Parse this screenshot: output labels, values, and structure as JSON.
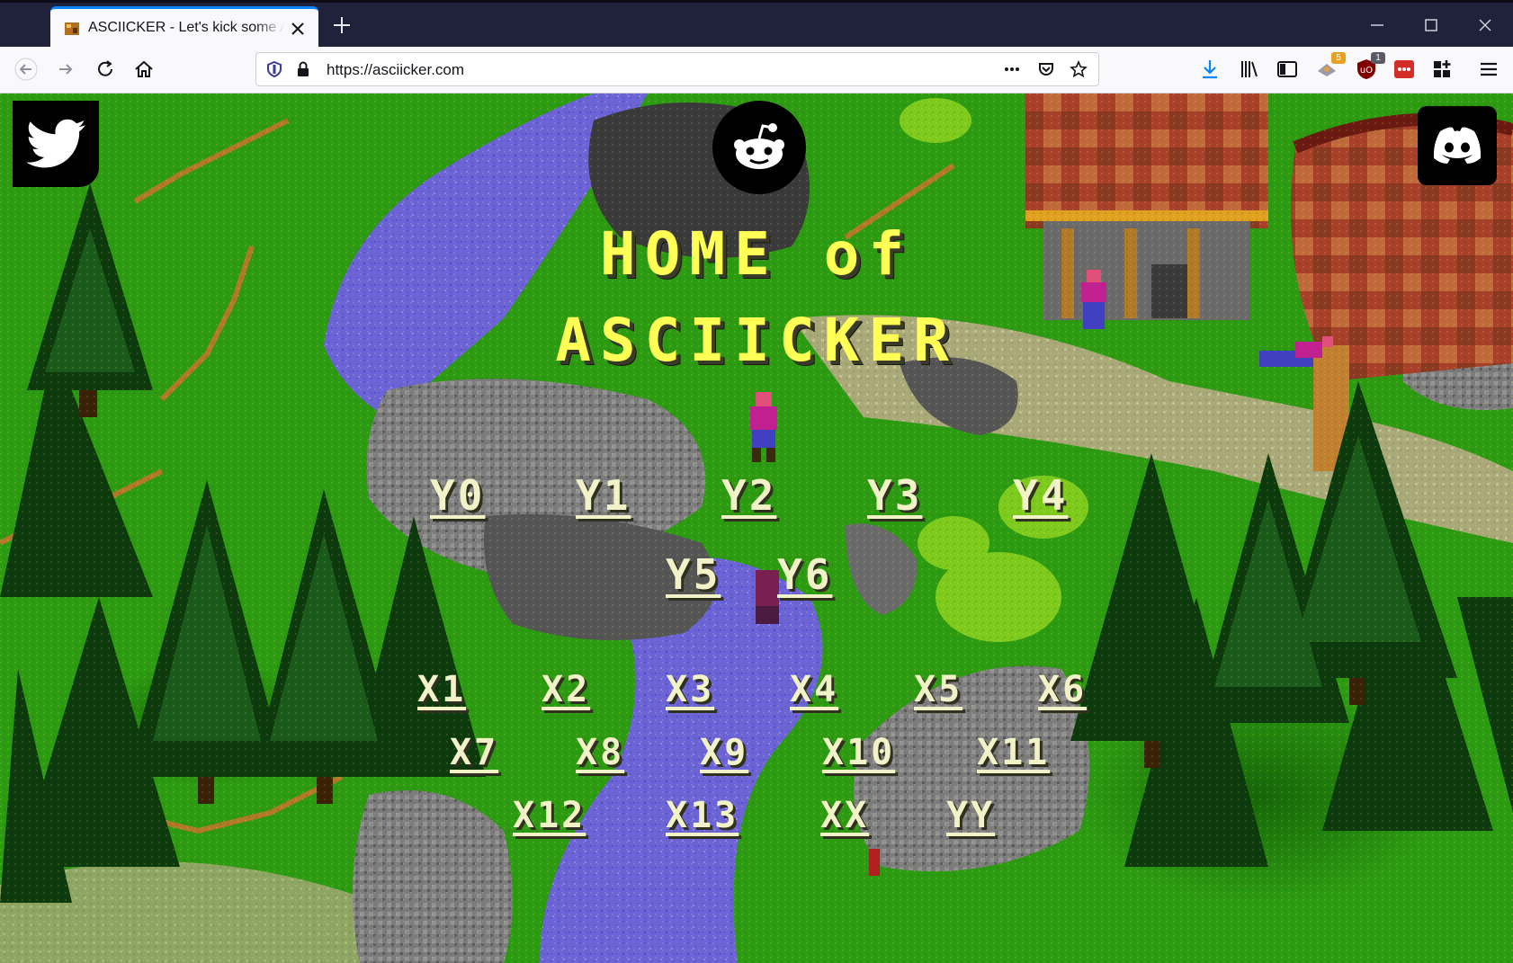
{
  "browser": {
    "tab_title": "ASCIICKER - Let's kick some ASCII",
    "url": "https://asciicker.com",
    "badges": {
      "ext1": "5",
      "ublock": "1"
    },
    "accent": "#0a84ff"
  },
  "page": {
    "title_line1": "HOME of",
    "title_line2": "ASCIICKER",
    "social": [
      "twitter-icon",
      "reddit-icon",
      "discord-icon"
    ],
    "y_links": [
      "Y0",
      "Y1",
      "Y2",
      "Y3",
      "Y4",
      "Y5",
      "Y6"
    ],
    "x_links": [
      "X1",
      "X2",
      "X3",
      "X4",
      "X5",
      "X6",
      "X7",
      "X8",
      "X9",
      "X10",
      "X11",
      "X12",
      "X13",
      "XX",
      "YY"
    ],
    "colors": {
      "title": "#ffff55",
      "links": "#f2f2c8",
      "grass": "#2d9b12",
      "water": "#6b63d6"
    }
  }
}
